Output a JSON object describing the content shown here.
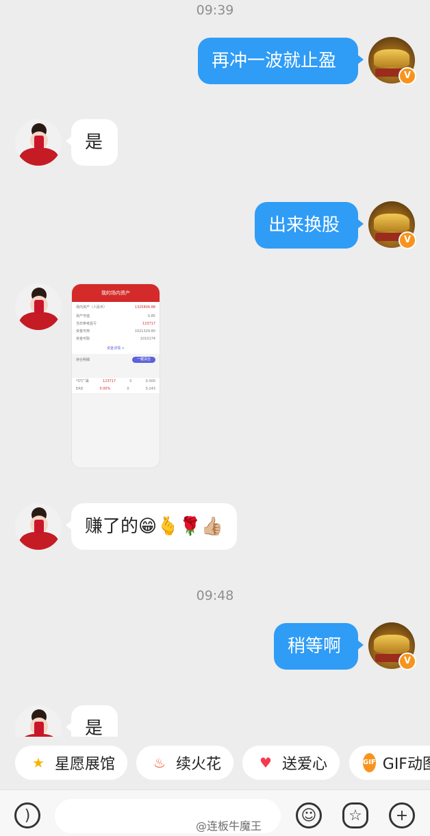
{
  "messages": {
    "time1": "09:39",
    "m1": "再冲一波就止盈",
    "m2": "是",
    "m3": "出来换股",
    "m5": "赚了的😁🫰🌹👍🏼",
    "time2": "09:48",
    "m6": "稍等啊",
    "m7": "是"
  },
  "screenshot": {
    "title": "我的场内资产",
    "total_label": "场内资产（人民币）",
    "total_value": "1325806.88",
    "rows": [
      {
        "label": "资产市值",
        "value": "0.85"
      },
      {
        "label": "当日参考盈亏",
        "value": "123717"
      },
      {
        "label": "资金可用",
        "value": "1021329.80"
      },
      {
        "label": "资金可取",
        "value": "1010174"
      }
    ],
    "link": "资金详情 >",
    "section": "持仓明细",
    "button": "一键清仓",
    "holdings": [
      {
        "name": "*ST广晟",
        "pnl": "123717",
        "qty": "0",
        "val": "0.000"
      },
      {
        "name": "EAD",
        "pnl": "0.00%",
        "qty": "0",
        "val": "0.243"
      }
    ]
  },
  "quick_actions": [
    {
      "icon": "star-icon",
      "label": "星愿展馆"
    },
    {
      "icon": "fire-icon",
      "label": "续火花"
    },
    {
      "icon": "heart-icon",
      "label": "送爱心"
    },
    {
      "icon": "gif-icon",
      "label": "GIF动图"
    }
  ],
  "badge": "V",
  "gif_badge": "GIF",
  "watermark": "@连板牛魔王"
}
